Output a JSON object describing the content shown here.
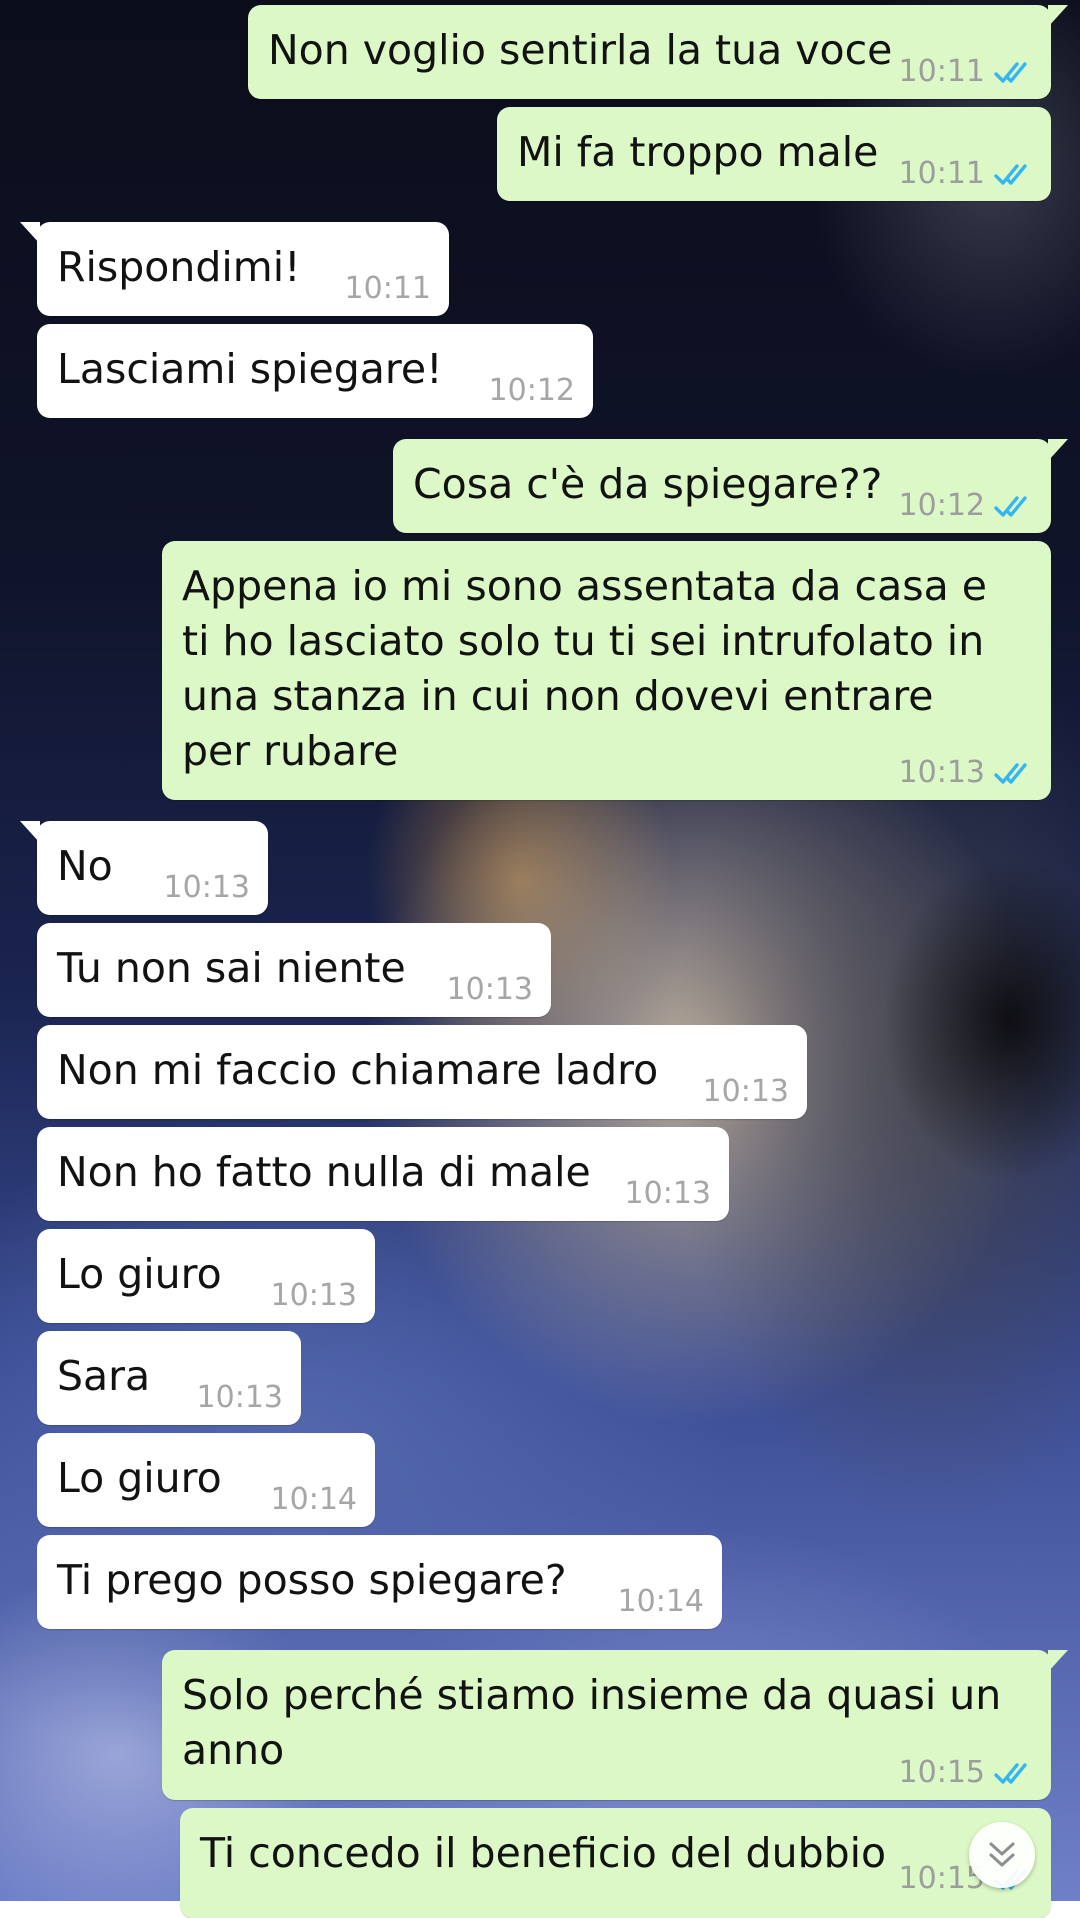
{
  "theme": {
    "incoming_bubble": "#ffffff",
    "outgoing_bubble": "#dcf8c6",
    "read_tick_color": "#34b7f1"
  },
  "messages": [
    {
      "direction": "out",
      "text": "Non voglio sentirla la tua voce",
      "time": "10:11",
      "status": "read"
    },
    {
      "direction": "out",
      "text": "Mi fa troppo male",
      "time": "10:11",
      "status": "read"
    },
    {
      "direction": "in",
      "text": "Rispondimi!",
      "time": "10:11"
    },
    {
      "direction": "in",
      "text": "Lasciami spiegare!",
      "time": "10:12"
    },
    {
      "direction": "out",
      "text": "Cosa c'è da spiegare??",
      "time": "10:12",
      "status": "read"
    },
    {
      "direction": "out",
      "text": "Appena io mi sono assentata da casa e ti ho lasciato solo tu ti sei intrufolato in una stanza in cui non dovevi entrare per rubare",
      "time": "10:13",
      "status": "read"
    },
    {
      "direction": "in",
      "text": "No",
      "time": "10:13"
    },
    {
      "direction": "in",
      "text": "Tu non sai niente",
      "time": "10:13"
    },
    {
      "direction": "in",
      "text": "Non mi faccio chiamare ladro",
      "time": "10:13"
    },
    {
      "direction": "in",
      "text": "Non ho fatto nulla di male",
      "time": "10:13"
    },
    {
      "direction": "in",
      "text": "Lo giuro",
      "time": "10:13"
    },
    {
      "direction": "in",
      "text": "Sara",
      "time": "10:13"
    },
    {
      "direction": "in",
      "text": "Lo giuro",
      "time": "10:14"
    },
    {
      "direction": "in",
      "text": "Ti prego posso spiegare?",
      "time": "10:14"
    },
    {
      "direction": "out",
      "text": "Solo perché stiamo insieme da quasi un anno",
      "time": "10:15",
      "status": "read"
    },
    {
      "direction": "out",
      "text": "Ti concedo il beneficio del dubbio",
      "time": "10:15",
      "status": "read"
    }
  ],
  "scroll_button": {
    "icon": "double-chevron-down-icon"
  }
}
